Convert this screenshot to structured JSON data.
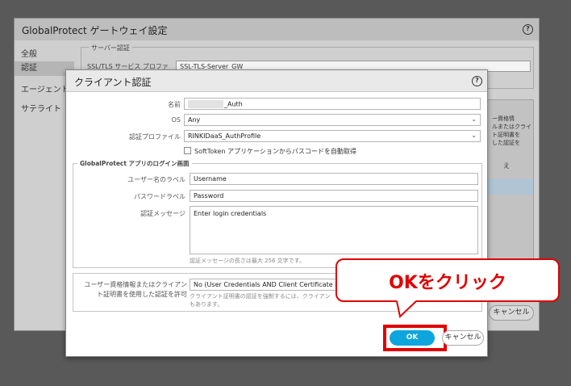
{
  "background_window": {
    "title": "GlobalProtect ゲートウェイ設定",
    "help": "?",
    "sidebar": [
      "全般",
      "認証",
      "エージェント",
      "サテライト"
    ],
    "server_auth_group": "サーバー認証",
    "ssl_profile_label": "SSL/TLS サービス プロファ",
    "ssl_profile_value": "SSL-TLS-Server_GW",
    "right_panel_text": [
      "ー資格情",
      "ルまたはクライ",
      "ト証明書を",
      "した認証を",
      "え"
    ],
    "cancel": "キャンセル"
  },
  "dialog": {
    "title": "クライアント認証",
    "help": "?",
    "name_label": "名前",
    "name_value": "_Auth",
    "os_label": "OS",
    "os_value": "Any",
    "profile_label": "認証プロファイル",
    "profile_value": "RINKIDaaS_AuthProfile",
    "softtoken_label": "SoftToken アプリケーションからパスコードを自動取得",
    "login_group_title": "GlobalProtect アプリのログイン画面",
    "username_label": "ユーザー名のラベル",
    "username_value": "Username",
    "password_label": "パスワードラベル",
    "password_value": "Password",
    "message_label": "認証メッセージ",
    "message_value": "Enter login credentials",
    "message_hint": "認証メッセージの長さは最大 256 文字です。",
    "allow_label_1": "ユーザー資格情報またはクライアン",
    "allow_label_2": "ト証明書を使用した認証を許可",
    "allow_value": "No (User Credentials AND Client Certificate Required)",
    "allow_hint_1": "クライアント証明書の認証を強制するには、クライアン",
    "allow_hint_2": "もあります。",
    "ok": "OK",
    "cancel": "キャンセル"
  },
  "callout": {
    "text": "OKをクリック"
  },
  "colors": {
    "accent": "#0da5dd",
    "highlight": "#e00000"
  }
}
